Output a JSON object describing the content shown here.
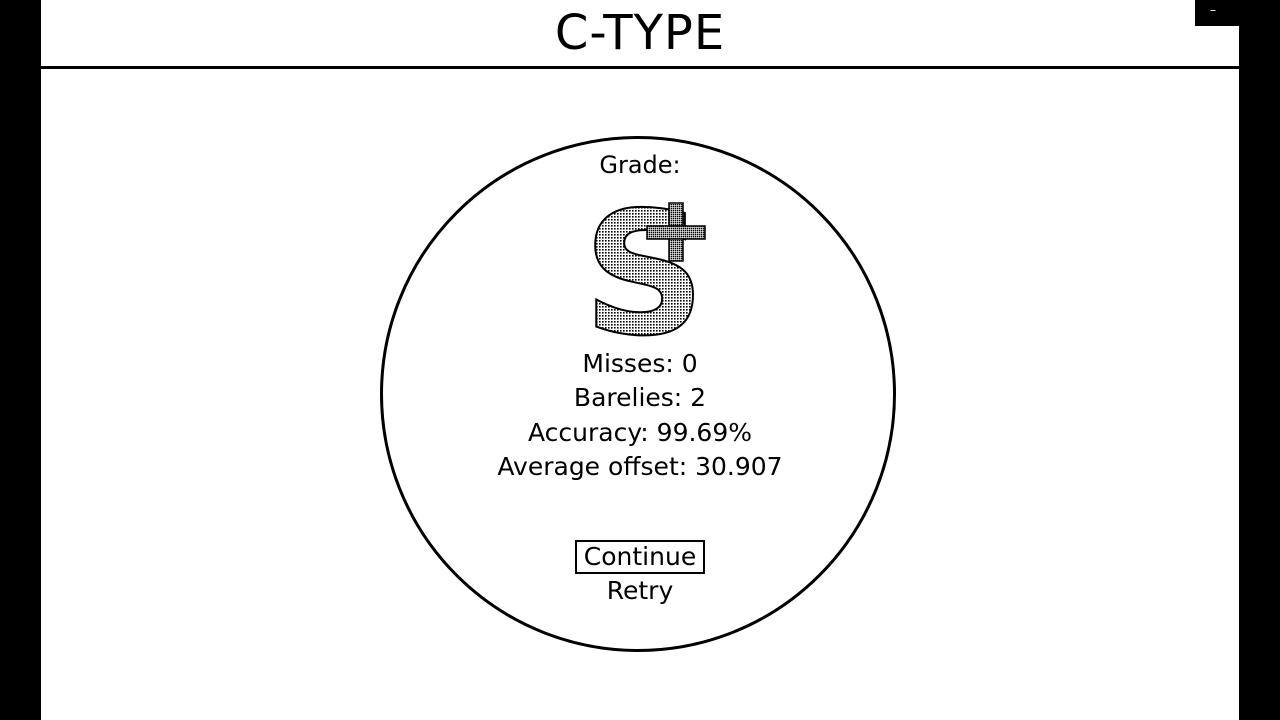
{
  "game": {
    "title": "C-TYPE",
    "menu_glyph": "–"
  },
  "results": {
    "grade_label": "Grade:",
    "grade": {
      "letter": "S",
      "modifier": "+"
    },
    "misses": "Misses: 0",
    "barelies": "Barelies: 2",
    "accuracy": "Accuracy: 99.69%",
    "average_offset": "Average offset: 30.907"
  },
  "menu": {
    "continue_label": "Continue",
    "retry_label": "Retry",
    "selected": "Continue"
  },
  "colors": {
    "background": "#000000",
    "panel": "#ffffff",
    "ink": "#000000"
  }
}
